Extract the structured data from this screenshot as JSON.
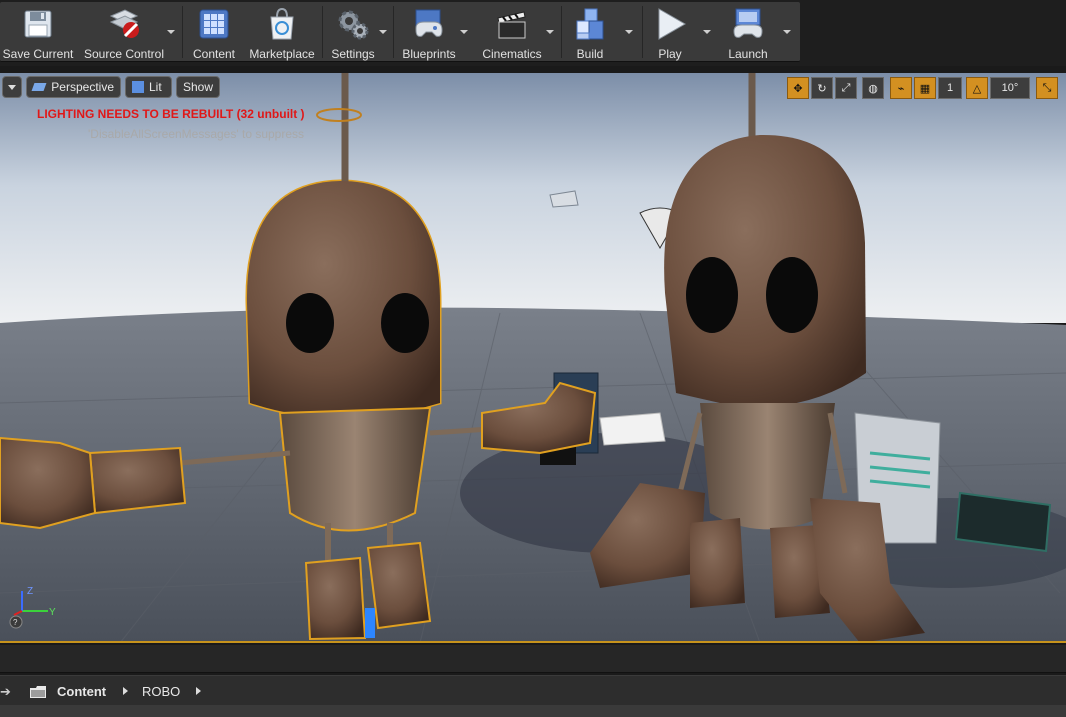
{
  "toolbar": {
    "save_current": "Save Current",
    "source_control": "Source Control",
    "content": "Content",
    "marketplace": "Marketplace",
    "settings": "Settings",
    "blueprints": "Blueprints",
    "cinematics": "Cinematics",
    "build": "Build",
    "play": "Play",
    "launch": "Launch"
  },
  "viewport": {
    "perspective": "Perspective",
    "lit": "Lit",
    "show": "Show",
    "warning": "LIGHTING NEEDS TO BE REBUILT (32 unbuilt )",
    "suppress_hint": "'DisableAllScreenMessages' to suppress",
    "grid_snap_value": "1",
    "rotation_snap_value": "10°",
    "axis_z": "Z",
    "axis_y": "Y",
    "accent_color": "#d39021",
    "warning_color": "#e01818"
  },
  "content_browser": {
    "breadcrumb": [
      "Content",
      "ROBO"
    ]
  },
  "icons": {
    "save": "floppy-disk-icon",
    "source_control": "source-control-icon",
    "content": "content-grid-icon",
    "marketplace": "marketplace-bag-icon",
    "settings": "gear-icon",
    "blueprints": "blueprint-controller-icon",
    "cinematics": "clapperboard-icon",
    "build": "build-cubes-icon",
    "play": "play-icon",
    "launch": "launch-gamepad-icon",
    "folder": "folder-icon"
  }
}
